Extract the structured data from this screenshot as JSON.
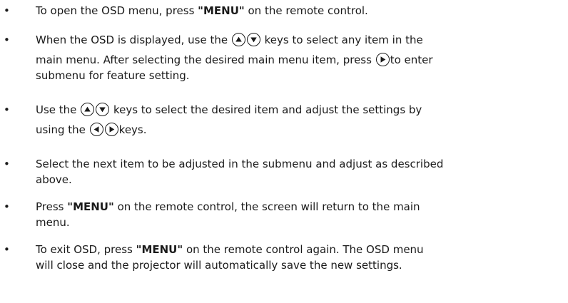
{
  "items": [
    {
      "p1": "To open the OSD menu, press ",
      "kw": "\"MENU\"",
      "p2": " on the remote control."
    },
    {
      "l1a": "When the OSD is displayed, use the ",
      "l1b": " keys to select any item in the",
      "l2a": "main menu. After selecting the desired main menu item, press ",
      "l2b": "to enter",
      "l3": "submenu for feature setting."
    },
    {
      "l1a": "Use the ",
      "l1b": " keys to select the desired item and adjust the settings by",
      "l2a": "using the ",
      "l2b": "keys."
    },
    {
      "l1": "Select the next item to be adjusted in the submenu and adjust as described",
      "l2": "above."
    },
    {
      "p1": "Press ",
      "kw": "\"MENU\"",
      "p2": " on the remote control, the screen will return to the main",
      "l2": "menu."
    },
    {
      "p1": "To exit OSD, press ",
      "kw": "\"MENU\"",
      "p2": " on the remote control again. The OSD menu",
      "l2": "will close and the projector will automatically save the new settings."
    }
  ],
  "bullet_char": "•",
  "key_icons": [
    "up-arrow-key-icon",
    "down-arrow-key-icon",
    "left-arrow-key-icon",
    "right-arrow-key-icon"
  ]
}
